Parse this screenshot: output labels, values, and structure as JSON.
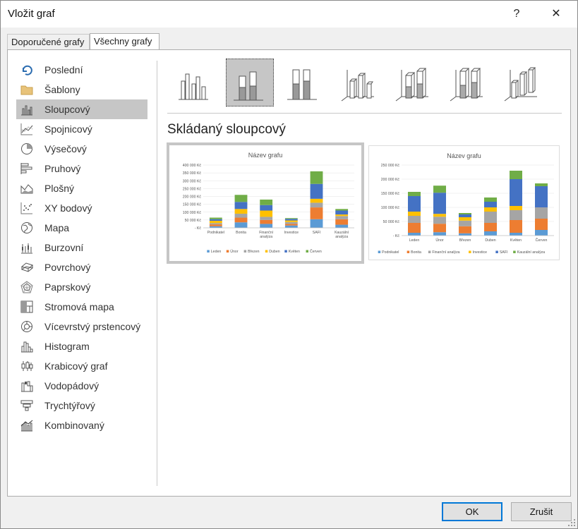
{
  "window": {
    "title": "Vložit graf",
    "help": "?",
    "close": "✕"
  },
  "tabs": [
    {
      "label": "Doporučené grafy",
      "active": false
    },
    {
      "label": "Všechny grafy",
      "active": true
    }
  ],
  "sidebar": {
    "items": [
      {
        "label": "Poslední",
        "icon": "recent-icon"
      },
      {
        "label": "Šablony",
        "icon": "folder-icon"
      },
      {
        "label": "Sloupcový",
        "icon": "column-chart-icon",
        "selected": true
      },
      {
        "label": "Spojnicový",
        "icon": "line-chart-icon"
      },
      {
        "label": "Výsečový",
        "icon": "pie-chart-icon"
      },
      {
        "label": "Pruhový",
        "icon": "bar-chart-icon"
      },
      {
        "label": "Plošný",
        "icon": "area-chart-icon"
      },
      {
        "label": "XY bodový",
        "icon": "scatter-chart-icon"
      },
      {
        "label": "Mapa",
        "icon": "map-chart-icon"
      },
      {
        "label": "Burzovní",
        "icon": "stock-chart-icon"
      },
      {
        "label": "Povrchový",
        "icon": "surface-chart-icon"
      },
      {
        "label": "Paprskový",
        "icon": "radar-chart-icon"
      },
      {
        "label": "Stromová mapa",
        "icon": "treemap-chart-icon"
      },
      {
        "label": "Vícevrstvý prstencový",
        "icon": "sunburst-chart-icon"
      },
      {
        "label": "Histogram",
        "icon": "histogram-chart-icon"
      },
      {
        "label": "Krabicový graf",
        "icon": "box-whisker-chart-icon"
      },
      {
        "label": "Vodopádový",
        "icon": "waterfall-chart-icon"
      },
      {
        "label": "Trychtýřový",
        "icon": "funnel-chart-icon"
      },
      {
        "label": "Kombinovaný",
        "icon": "combo-chart-icon"
      }
    ]
  },
  "variants": [
    {
      "name": "clustered-column",
      "selected": false
    },
    {
      "name": "stacked-column",
      "selected": true
    },
    {
      "name": "100-stacked-column",
      "selected": false
    },
    {
      "name": "3d-clustered-column",
      "selected": false
    },
    {
      "name": "3d-stacked-column",
      "selected": false
    },
    {
      "name": "3d-100-stacked-column",
      "selected": false
    },
    {
      "name": "3d-column",
      "selected": false
    }
  ],
  "subtitle": "Skládaný sloupcový",
  "colors": {
    "blue": "#5b9bd5",
    "orange": "#ed7d31",
    "gray": "#a5a5a5",
    "gold": "#ffc000",
    "darkblue": "#4472c4",
    "green": "#70ad47",
    "accent": "#0078d7"
  },
  "chart_data": [
    {
      "type": "bar",
      "stacked": true,
      "title": "Název grafu",
      "categories": [
        "Podnikatel",
        "Bonita",
        "Finanční analýza",
        "Investice",
        "SAFI",
        "Kauzální analýza"
      ],
      "series": [
        {
          "name": "Leden",
          "values": [
            10000,
            35000,
            25000,
            15000,
            55000,
            20000
          ]
        },
        {
          "name": "Únor",
          "values": [
            12000,
            30000,
            25000,
            10000,
            75000,
            35000
          ]
        },
        {
          "name": "Březen",
          "values": [
            8000,
            25000,
            20000,
            12000,
            30000,
            20000
          ]
        },
        {
          "name": "Duben",
          "values": [
            15000,
            30000,
            40000,
            10000,
            25000,
            10000
          ]
        },
        {
          "name": "Květen",
          "values": [
            10000,
            45000,
            35000,
            10000,
            95000,
            25000
          ]
        },
        {
          "name": "Červen",
          "values": [
            10000,
            45000,
            35000,
            5000,
            80000,
            10000
          ]
        }
      ],
      "yticks": [
        "400 000 Kč",
        "350 000 Kč",
        "300 000 Kč",
        "250 000 Kč",
        "200 000 Kč",
        "150 000 Kč",
        "100 000 Kč",
        "50 000 Kč",
        "- Kč"
      ],
      "ylim": [
        0,
        400000
      ],
      "legend": "bottom"
    },
    {
      "type": "bar",
      "stacked": true,
      "title": "Název grafu",
      "categories": [
        "Leden",
        "Únor",
        "Březen",
        "Duben",
        "Květen",
        "Červen"
      ],
      "series": [
        {
          "name": "Podnikatel",
          "values": [
            10000,
            12000,
            8000,
            15000,
            10000,
            20000
          ]
        },
        {
          "name": "Bonita",
          "values": [
            35000,
            30000,
            25000,
            30000,
            45000,
            40000
          ]
        },
        {
          "name": "Finanční analýza",
          "values": [
            25000,
            25000,
            20000,
            40000,
            35000,
            40000
          ]
        },
        {
          "name": "Investice",
          "values": [
            15000,
            10000,
            12000,
            15000,
            15000,
            0
          ]
        },
        {
          "name": "SAFI",
          "values": [
            55000,
            75000,
            10000,
            20000,
            95000,
            75000
          ]
        },
        {
          "name": "Kauzální analýza",
          "values": [
            15000,
            25000,
            5000,
            15000,
            30000,
            10000
          ]
        }
      ],
      "yticks": [
        "250 000 Kč",
        "200 000 Kč",
        "150 000 Kč",
        "100 000 Kč",
        "50 000 Kč",
        "- Kč"
      ],
      "ylim": [
        0,
        250000
      ],
      "legend": "bottom"
    }
  ],
  "buttons": {
    "ok": "OK",
    "cancel": "Zrušit"
  }
}
